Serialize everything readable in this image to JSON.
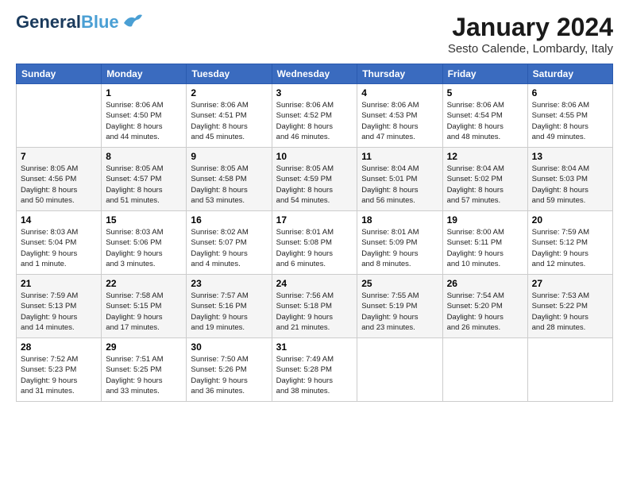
{
  "header": {
    "logo_line1": "General",
    "logo_line2": "Blue",
    "month_title": "January 2024",
    "subtitle": "Sesto Calende, Lombardy, Italy"
  },
  "weekdays": [
    "Sunday",
    "Monday",
    "Tuesday",
    "Wednesday",
    "Thursday",
    "Friday",
    "Saturday"
  ],
  "weeks": [
    [
      {
        "day": "",
        "info": ""
      },
      {
        "day": "1",
        "info": "Sunrise: 8:06 AM\nSunset: 4:50 PM\nDaylight: 8 hours\nand 44 minutes."
      },
      {
        "day": "2",
        "info": "Sunrise: 8:06 AM\nSunset: 4:51 PM\nDaylight: 8 hours\nand 45 minutes."
      },
      {
        "day": "3",
        "info": "Sunrise: 8:06 AM\nSunset: 4:52 PM\nDaylight: 8 hours\nand 46 minutes."
      },
      {
        "day": "4",
        "info": "Sunrise: 8:06 AM\nSunset: 4:53 PM\nDaylight: 8 hours\nand 47 minutes."
      },
      {
        "day": "5",
        "info": "Sunrise: 8:06 AM\nSunset: 4:54 PM\nDaylight: 8 hours\nand 48 minutes."
      },
      {
        "day": "6",
        "info": "Sunrise: 8:06 AM\nSunset: 4:55 PM\nDaylight: 8 hours\nand 49 minutes."
      }
    ],
    [
      {
        "day": "7",
        "info": "Sunrise: 8:05 AM\nSunset: 4:56 PM\nDaylight: 8 hours\nand 50 minutes."
      },
      {
        "day": "8",
        "info": "Sunrise: 8:05 AM\nSunset: 4:57 PM\nDaylight: 8 hours\nand 51 minutes."
      },
      {
        "day": "9",
        "info": "Sunrise: 8:05 AM\nSunset: 4:58 PM\nDaylight: 8 hours\nand 53 minutes."
      },
      {
        "day": "10",
        "info": "Sunrise: 8:05 AM\nSunset: 4:59 PM\nDaylight: 8 hours\nand 54 minutes."
      },
      {
        "day": "11",
        "info": "Sunrise: 8:04 AM\nSunset: 5:01 PM\nDaylight: 8 hours\nand 56 minutes."
      },
      {
        "day": "12",
        "info": "Sunrise: 8:04 AM\nSunset: 5:02 PM\nDaylight: 8 hours\nand 57 minutes."
      },
      {
        "day": "13",
        "info": "Sunrise: 8:04 AM\nSunset: 5:03 PM\nDaylight: 8 hours\nand 59 minutes."
      }
    ],
    [
      {
        "day": "14",
        "info": "Sunrise: 8:03 AM\nSunset: 5:04 PM\nDaylight: 9 hours\nand 1 minute."
      },
      {
        "day": "15",
        "info": "Sunrise: 8:03 AM\nSunset: 5:06 PM\nDaylight: 9 hours\nand 3 minutes."
      },
      {
        "day": "16",
        "info": "Sunrise: 8:02 AM\nSunset: 5:07 PM\nDaylight: 9 hours\nand 4 minutes."
      },
      {
        "day": "17",
        "info": "Sunrise: 8:01 AM\nSunset: 5:08 PM\nDaylight: 9 hours\nand 6 minutes."
      },
      {
        "day": "18",
        "info": "Sunrise: 8:01 AM\nSunset: 5:09 PM\nDaylight: 9 hours\nand 8 minutes."
      },
      {
        "day": "19",
        "info": "Sunrise: 8:00 AM\nSunset: 5:11 PM\nDaylight: 9 hours\nand 10 minutes."
      },
      {
        "day": "20",
        "info": "Sunrise: 7:59 AM\nSunset: 5:12 PM\nDaylight: 9 hours\nand 12 minutes."
      }
    ],
    [
      {
        "day": "21",
        "info": "Sunrise: 7:59 AM\nSunset: 5:13 PM\nDaylight: 9 hours\nand 14 minutes."
      },
      {
        "day": "22",
        "info": "Sunrise: 7:58 AM\nSunset: 5:15 PM\nDaylight: 9 hours\nand 17 minutes."
      },
      {
        "day": "23",
        "info": "Sunrise: 7:57 AM\nSunset: 5:16 PM\nDaylight: 9 hours\nand 19 minutes."
      },
      {
        "day": "24",
        "info": "Sunrise: 7:56 AM\nSunset: 5:18 PM\nDaylight: 9 hours\nand 21 minutes."
      },
      {
        "day": "25",
        "info": "Sunrise: 7:55 AM\nSunset: 5:19 PM\nDaylight: 9 hours\nand 23 minutes."
      },
      {
        "day": "26",
        "info": "Sunrise: 7:54 AM\nSunset: 5:20 PM\nDaylight: 9 hours\nand 26 minutes."
      },
      {
        "day": "27",
        "info": "Sunrise: 7:53 AM\nSunset: 5:22 PM\nDaylight: 9 hours\nand 28 minutes."
      }
    ],
    [
      {
        "day": "28",
        "info": "Sunrise: 7:52 AM\nSunset: 5:23 PM\nDaylight: 9 hours\nand 31 minutes."
      },
      {
        "day": "29",
        "info": "Sunrise: 7:51 AM\nSunset: 5:25 PM\nDaylight: 9 hours\nand 33 minutes."
      },
      {
        "day": "30",
        "info": "Sunrise: 7:50 AM\nSunset: 5:26 PM\nDaylight: 9 hours\nand 36 minutes."
      },
      {
        "day": "31",
        "info": "Sunrise: 7:49 AM\nSunset: 5:28 PM\nDaylight: 9 hours\nand 38 minutes."
      },
      {
        "day": "",
        "info": ""
      },
      {
        "day": "",
        "info": ""
      },
      {
        "day": "",
        "info": ""
      }
    ]
  ]
}
